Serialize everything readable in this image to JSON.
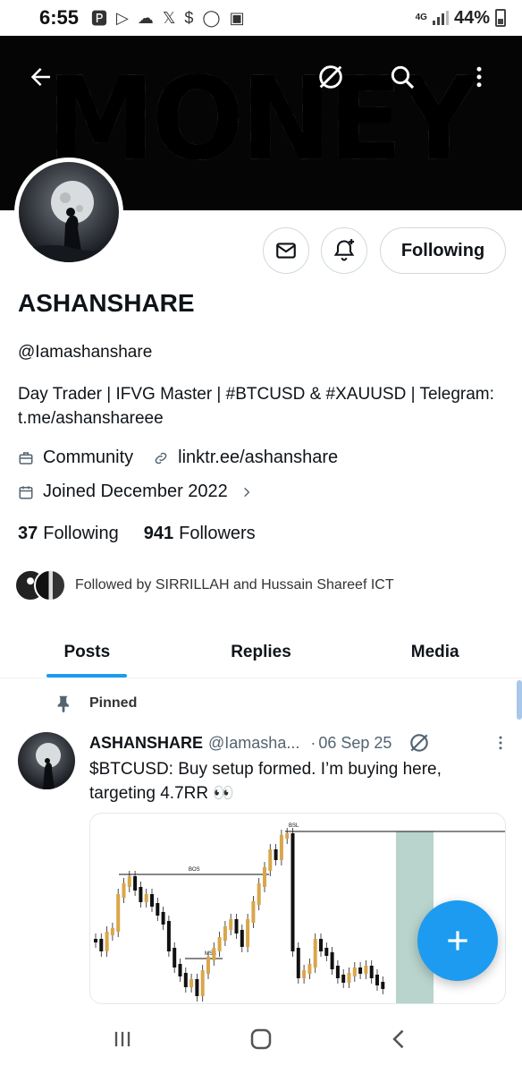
{
  "status_bar": {
    "time": "6:55",
    "network": "4G",
    "battery": "44%"
  },
  "banner": {
    "text": "MONEY"
  },
  "profile": {
    "display_name": "ASHANSHARE",
    "handle": "@Iamashanshare",
    "bio": "Day Trader | IFVG Master | #BTCUSD & #XAUUSD | Telegram: t.me/ashanshareee",
    "category": "Community",
    "link": "linktr.ee/ashanshare",
    "joined": "Joined December 2022",
    "following_count": "37",
    "following_label": "Following",
    "followers_count": "941",
    "followers_label": "Followers",
    "followed_by": "Followed by SIRRILLAH and Hussain Shareef ICT",
    "follow_button": "Following"
  },
  "tabs": [
    {
      "label": "Posts",
      "active": true
    },
    {
      "label": "Replies",
      "active": false
    },
    {
      "label": "Media",
      "active": false
    }
  ],
  "post": {
    "pinned_label": "Pinned",
    "name": "ASHANSHARE",
    "handle": "@Iamasha...",
    "date": "06 Sep 25",
    "text": "$BTCUSD: Buy setup formed. I’m buying here, targeting 4.7RR 👀",
    "chart_labels": {
      "bsl": "BSL",
      "bos": "BOS",
      "mss": "MSS"
    }
  },
  "colors": {
    "accent": "#1d9bf0",
    "text": "#0f1419",
    "muted": "#536471"
  }
}
